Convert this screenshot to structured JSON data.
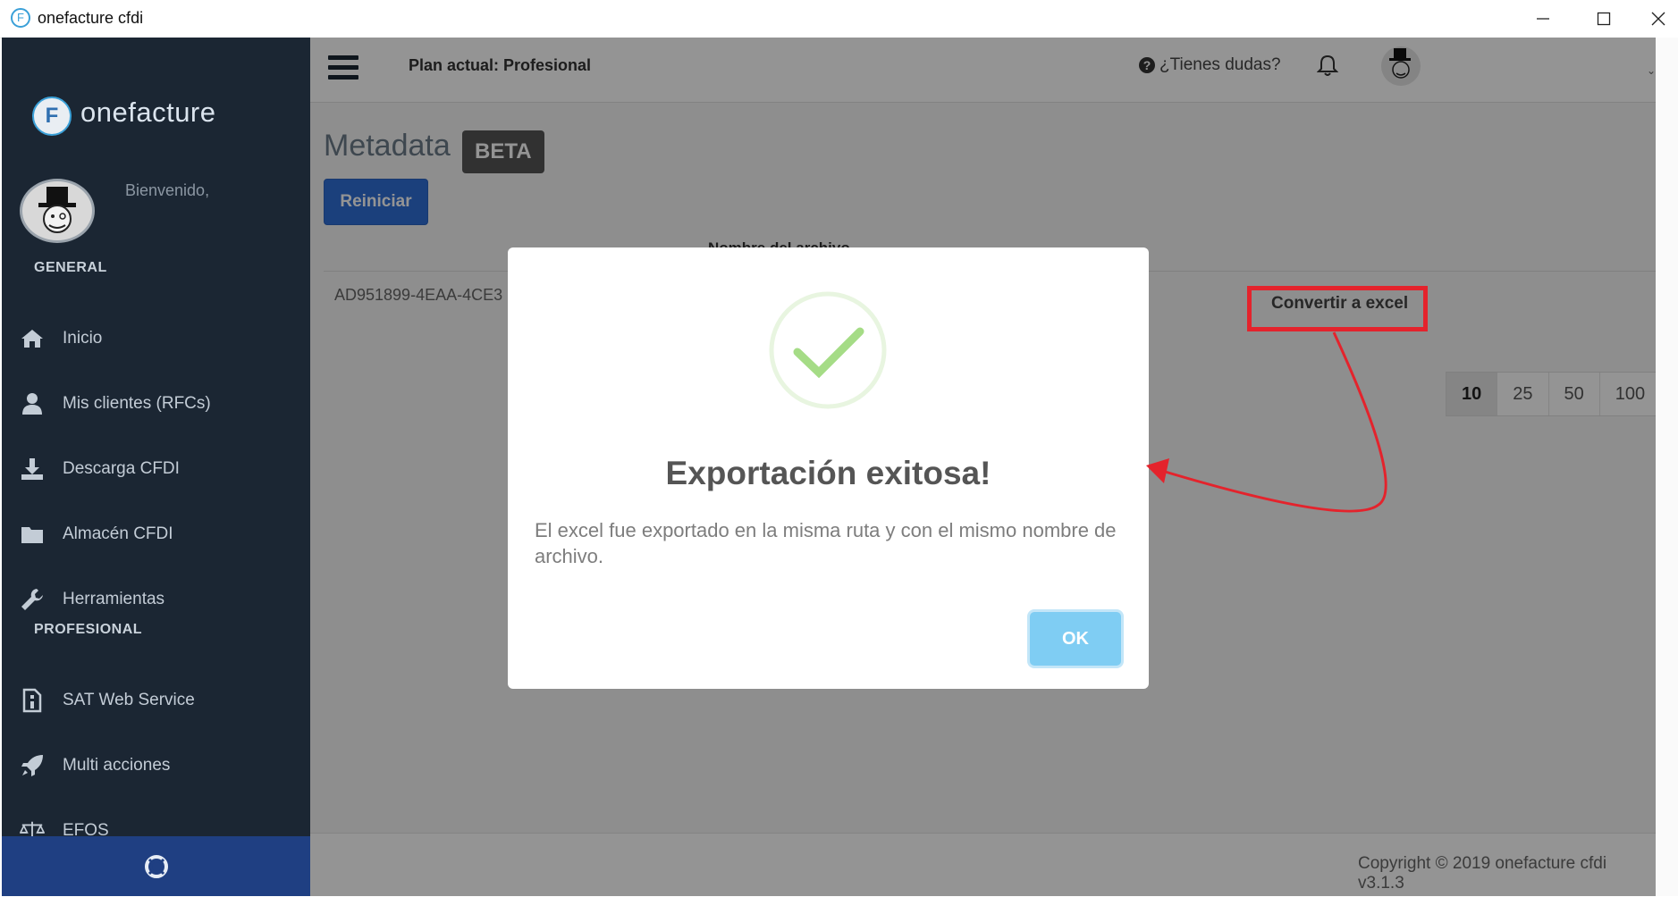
{
  "window": {
    "title": "onefacture cfdi"
  },
  "sidebar": {
    "logo_text": "onefacture",
    "logo_letter": "F",
    "welcome": "Bienvenido,",
    "sections": {
      "general": "GENERAL",
      "profesional": "PROFESIONAL"
    },
    "items": [
      {
        "label": "Inicio",
        "icon": "home-icon"
      },
      {
        "label": "Mis clientes (RFCs)",
        "icon": "user-icon"
      },
      {
        "label": "Descarga CFDI",
        "icon": "download-icon"
      },
      {
        "label": "Almacén CFDI",
        "icon": "folder-icon"
      },
      {
        "label": "Herramientas",
        "icon": "wrench-icon"
      },
      {
        "label": "SAT Web Service",
        "icon": "document-icon"
      },
      {
        "label": "Multi acciones",
        "icon": "rocket-icon"
      },
      {
        "label": "EFOS",
        "icon": "scale-icon"
      }
    ],
    "help_icon": "lifebuoy-icon"
  },
  "topbar": {
    "plan": "Plan actual: Profesional",
    "help": "¿Tienes dudas?"
  },
  "page": {
    "title": "Metadata",
    "badge": "BETA",
    "reset_button": "Reiniciar",
    "table_header": "Nombre del archivo",
    "file_name": "AD951899-4EAA-4CE3",
    "convert_button": "Convertir a excel",
    "page_sizes": [
      "10",
      "25",
      "50",
      "100"
    ]
  },
  "footer": {
    "copyright": "Copyright © 2019 onefacture cfdi v3.1.3"
  },
  "modal": {
    "title": "Exportación exitosa!",
    "message": "El excel fue exportado en la misma ruta y con el mismo nombre de archivo.",
    "ok_button": "OK"
  },
  "colors": {
    "sidebar_bg": "#1b2633",
    "primary": "#2f6fd6",
    "success": "#a5dc86",
    "ok_button": "#7fcdf3",
    "annotation": "#e4232c"
  }
}
